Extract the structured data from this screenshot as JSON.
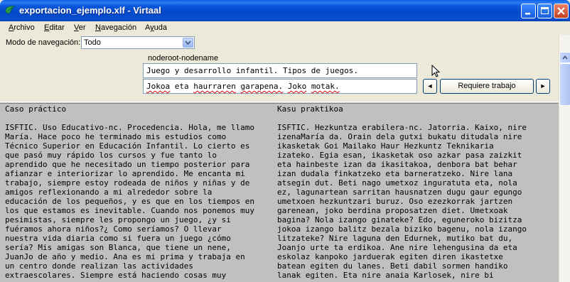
{
  "window": {
    "title": "exportacion_ejemplo.xlf - Virtaal"
  },
  "menu": [
    {
      "label": "Archivo",
      "underline": "A"
    },
    {
      "label": "Editar",
      "underline": "E"
    },
    {
      "label": "Ver",
      "underline": "V"
    },
    {
      "label": "Navegación",
      "underline": "N"
    },
    {
      "label": "Ayuda",
      "underline": "y"
    }
  ],
  "navigation": {
    "label": "Modo de navegación:",
    "selected": "Todo"
  },
  "unit": {
    "context": "noderoot-nodename",
    "source": "Juego y desarrollo infantil. Tipos de juegos.",
    "target_words": [
      "Jokoa",
      "eta",
      "haurraren",
      "garapena.",
      "Joko",
      "motak."
    ],
    "requires_work_label": "Requiere trabajo",
    "prev_label": "◄",
    "next_label": "►"
  },
  "lower": {
    "source_header": "Caso práctico",
    "target_header": "Kasu praktikoa",
    "source_lines": [
      "ISFTIC. Uso Educativo-nc. Procedencia. Hola, me llamo",
      "María. Hace poco he terminado mis estudios como",
      "Técnico Superior en Educación Infantil. Lo cierto es",
      "que pasó muy rápido los cursos y fue tanto lo",
      "aprendido que he necesitado un tiempo posterior para",
      "afianzar e interiorizar lo aprendido. Me encanta mi",
      "trabajo, siempre estoy rodeada de niños y niñas y de",
      "amigos reflexionando a mi alrededor sobre la",
      "educación de los pequeños, y es que en los tiempos en",
      "los que estamos es inevitable. Cuando nos ponemos muy",
      "pesimistas, siempre les propongo un juego, ¿y si",
      "fuéramos ahora niños?¿ Como seríamos? O llevar",
      "nuestra vida diaria como si fuera un juego ¿cómo",
      "sería? Mis amigas son Blanca, que tiene un nene,",
      "JuanJo de año y medio. Ana es mi prima y trabaja en",
      "un centro donde realizan las actividades",
      "extraescolares. Siempre está haciendo cosas muy"
    ],
    "target_lines": [
      "ISFTIC. Hezkuntza erabilera-nc. Jatorria. Kaixo, nire",
      "izenaMaría da. Orain dela gutxi bukatu ditudala nire",
      "ikasketak Goi Mailako Haur Hezkuntz Teknikaria",
      "izateko. Egia esan, ikasketak oso azkar pasa zaizkit",
      "eta hainbeste izan da ikasitakoa, denbora bat behar",
      "izan dudala finkatzeko eta barneratzeko. Nire lana",
      "atsegin dut. Beti nago umetxoz inguratuta eta, nola",
      "ez, lagunartean sarritan hausnatzen dugu gaur egungo",
      "umetxoen hezkuntzari buruz. Oso ezezkorrak jartzen",
      "garenean, joko berdina proposatzen diet. Umetxoak",
      "bagina? Nola izango ginateke? Edo, eguneroko bizitza",
      "jokoa izango balitz bezala biziko bagenu, nola izango",
      "litzateke? Nire laguna den Edurnek, mutiko bat du,",
      "Joanjo urte ta erdikoa. Ane nire lehengusina da eta",
      "eskolaz kanpoko jarduerak egiten diren ikastetxe",
      "batean egiten du lanes. Beti dabil sormen handiko",
      "lanak egiten. Eta nire anaia Karlosek, nire bi"
    ]
  }
}
